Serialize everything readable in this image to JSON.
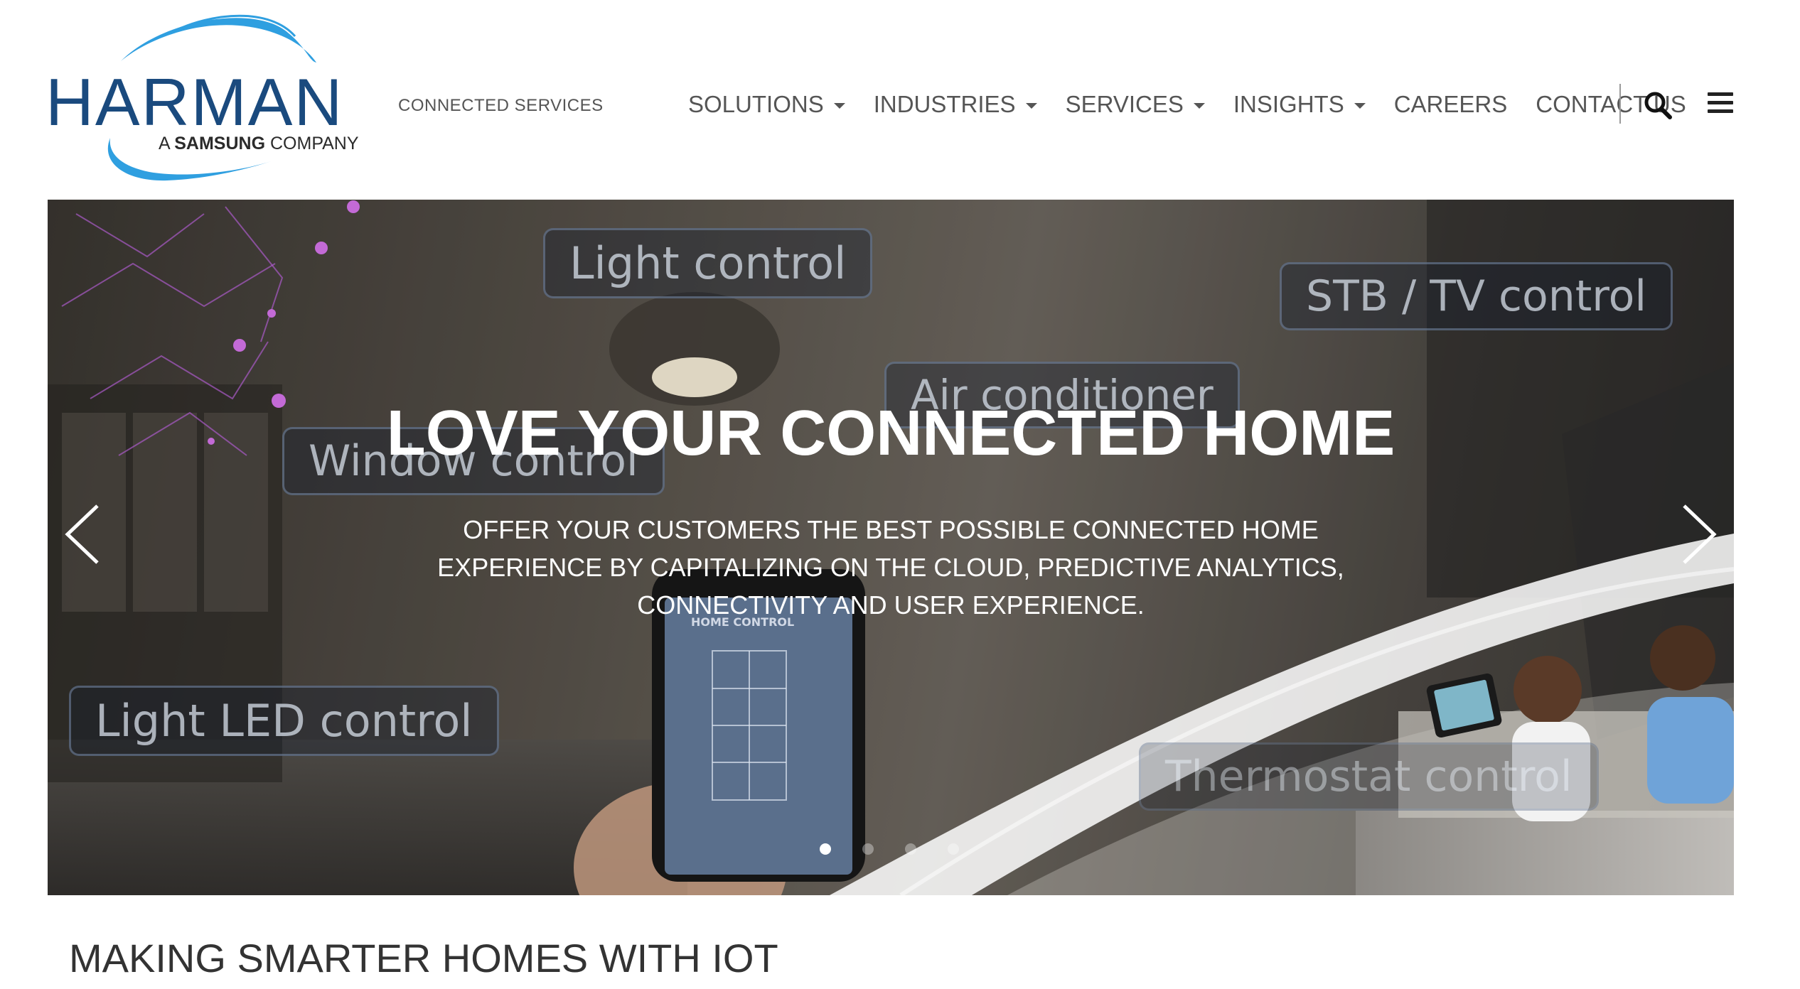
{
  "brand": {
    "logo_word": "HARMAN",
    "logo_sub_prefix": "A ",
    "logo_sub_bold": "SAMSUNG",
    "logo_sub_suffix": " COMPANY",
    "tagline": "CONNECTED SERVICES",
    "brand_color": "#1a4a7e",
    "swoosh_color": "#2f9fe0"
  },
  "nav": {
    "items": [
      {
        "label": "SOLUTIONS",
        "has_dropdown": true
      },
      {
        "label": "INDUSTRIES",
        "has_dropdown": true
      },
      {
        "label": "SERVICES",
        "has_dropdown": true
      },
      {
        "label": "INSIGHTS",
        "has_dropdown": true
      },
      {
        "label": "CAREERS",
        "has_dropdown": false
      },
      {
        "label": "CONTACT US",
        "has_dropdown": false
      }
    ],
    "search_icon": "search-icon",
    "menu_icon": "hamburger-menu-icon"
  },
  "hero": {
    "title": "LOVE YOUR CONNECTED HOME",
    "subtitle": "OFFER YOUR CUSTOMERS THE BEST POSSIBLE CONNECTED HOME EXPERIENCE BY CAPITALIZING ON THE CLOUD, PREDICTIVE ANALYTICS, CONNECTIVITY AND USER EXPERIENCE.",
    "image_labels": {
      "light_control": "Light control",
      "stb_tv_control": "STB / TV control",
      "air_conditioner": "Air conditioner",
      "window_control": "Window control",
      "light_led_control": "Light LED control",
      "thermostat_control": "Thermostat control",
      "home_control": "HOME CONTROL"
    },
    "slide_count": 4,
    "active_slide": 1,
    "prev_icon": "chevron-left-icon",
    "next_icon": "chevron-right-icon"
  },
  "section": {
    "title": "MAKING SMARTER HOMES WITH IOT"
  }
}
